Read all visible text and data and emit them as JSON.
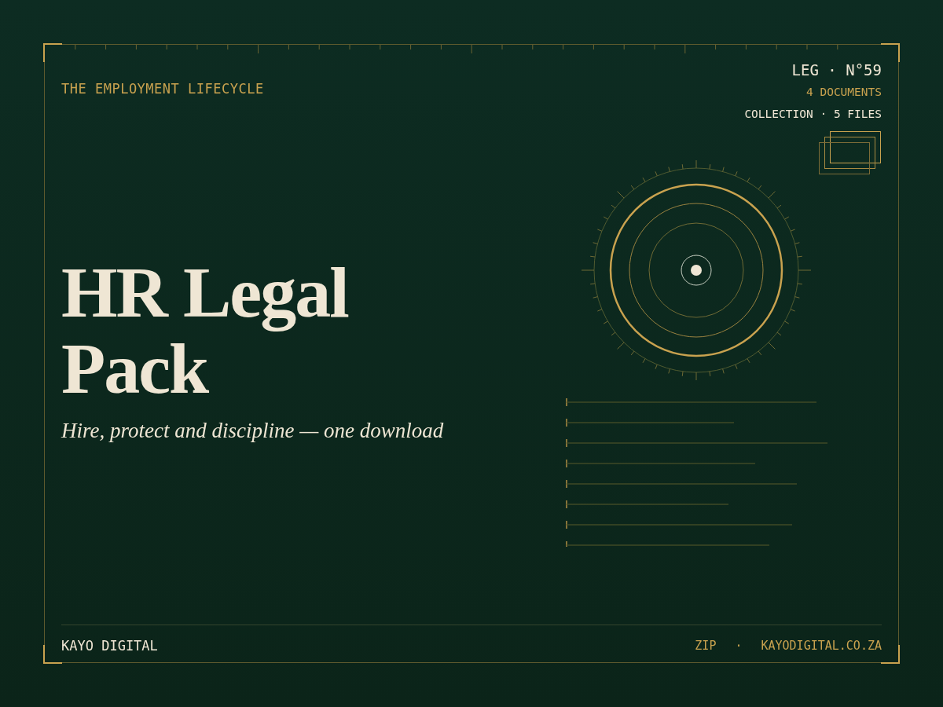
{
  "header": {
    "label": "THE EMPLOYMENT LIFECYCLE",
    "code": "LEG · N°59",
    "count": "4 DOCUMENTS",
    "collection": "COLLECTION · 5 FILES"
  },
  "title": "HR Legal Pack",
  "subtitle": "Hire, protect and discipline — one download",
  "footer": {
    "brand": "KAYO DIGITAL",
    "format": "ZIP",
    "separator": "·",
    "website": "KAYODIGITAL.CO.ZA"
  }
}
